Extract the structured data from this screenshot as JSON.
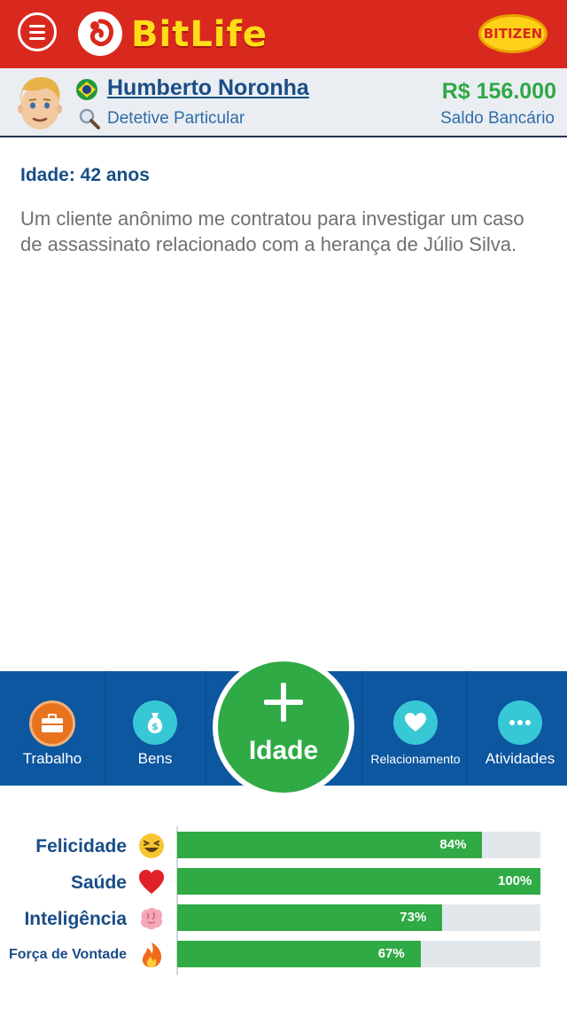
{
  "header": {
    "logo_text": "BitLife",
    "bitizen_label": "BITIZEN",
    "brand_color": "#d9291e"
  },
  "profile": {
    "name": "Humberto Noronha",
    "occupation": "Detetive Particular",
    "balance": "R$ 156.000",
    "balance_label": "Saldo Bancário",
    "flag": "brazil-flag-icon"
  },
  "story": {
    "age_heading": "Idade: 42 anos",
    "text": "Um cliente anônimo me contratou para investigar um caso de assassinato relacionado com a herança de Júlio Silva."
  },
  "actions": {
    "trabalho": "Trabalho",
    "bens": "Bens",
    "idade": "Idade",
    "relacionamento": "Relacionamento",
    "atividades": "Atividades"
  },
  "stats": [
    {
      "label": "Felicidade",
      "value": 84,
      "text": "84%",
      "icon": "laughing-face-icon"
    },
    {
      "label": "Saúde",
      "value": 100,
      "text": "100%",
      "icon": "heart-icon"
    },
    {
      "label": "Inteligência",
      "value": 73,
      "text": "73%",
      "icon": "brain-icon"
    },
    {
      "label": "Força de Vontade",
      "value": 67,
      "text": "67%",
      "icon": "fire-icon"
    }
  ]
}
